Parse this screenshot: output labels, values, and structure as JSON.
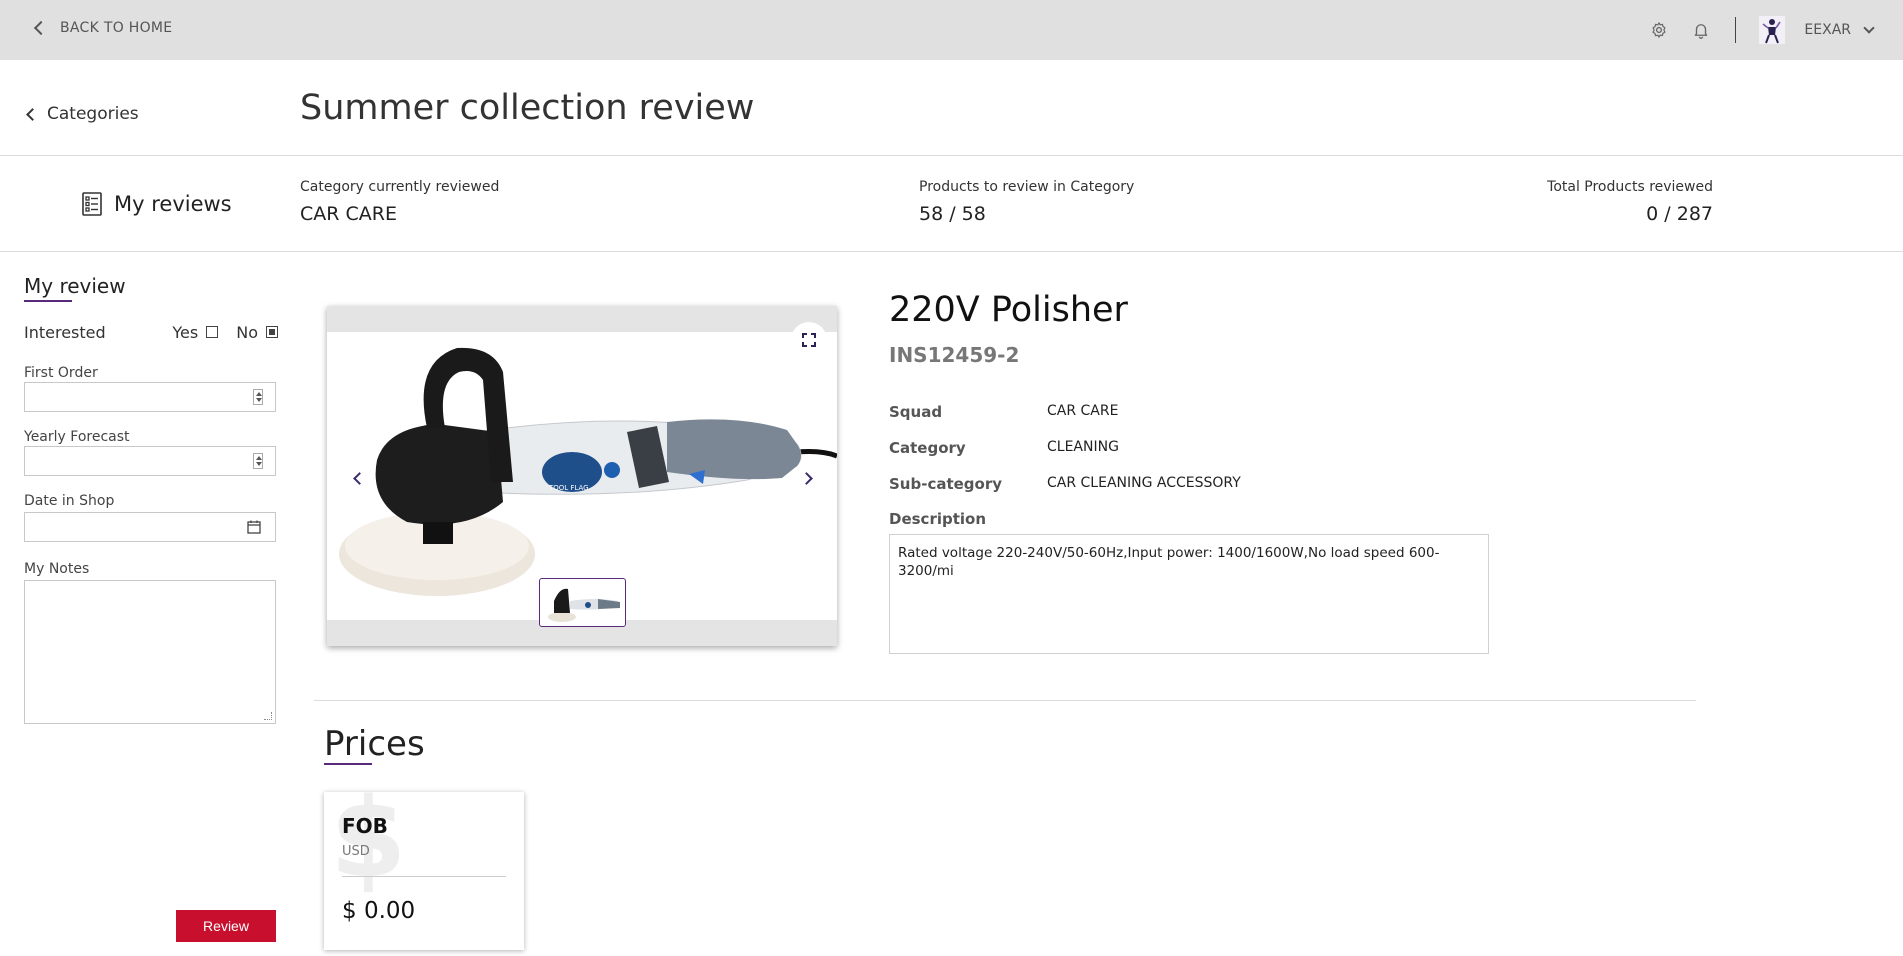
{
  "topbar": {
    "back_label": "BACK TO HOME",
    "user_name": "EEXAR"
  },
  "header": {
    "categories_label": "Categories",
    "title": "Summer collection review"
  },
  "stats": {
    "my_reviews_label": "My reviews",
    "category_caption": "Category currently reviewed",
    "category_value": "CAR CARE",
    "to_review_caption": "Products to review in Category",
    "to_review_value": "58 / 58",
    "total_caption": "Total Products reviewed",
    "total_value": "0 / 287"
  },
  "review_panel": {
    "title": "My review",
    "interested_label": "Interested",
    "yes_label": "Yes",
    "no_label": "No",
    "interested_yes": false,
    "interested_no": true,
    "first_order_label": "First Order",
    "first_order_value": "",
    "yearly_forecast_label": "Yearly Forecast",
    "yearly_forecast_value": "",
    "date_in_shop_label": "Date in Shop",
    "date_in_shop_value": "",
    "notes_label": "My Notes",
    "notes_value": "",
    "review_button": "Review"
  },
  "product": {
    "name": "220V Polisher",
    "code": "INS12459-2",
    "squad_label": "Squad",
    "squad_value": "CAR CARE",
    "category_label": "Category",
    "category_value": "CLEANING",
    "subcategory_label": "Sub-category",
    "subcategory_value": "CAR CLEANING ACCESSORY",
    "description_label": "Description",
    "description_value": "Rated voltage 220-240V/50-60Hz,Input power: 1400/1600W,No load speed 600-3200/mi",
    "image_brand_text": "TOOL FLAG"
  },
  "prices": {
    "title": "Prices",
    "cards": [
      {
        "label": "FOB",
        "currency": "USD",
        "amount": "$ 0.00"
      }
    ]
  },
  "colors": {
    "topbar_bg": "#e0e0e0",
    "accent_purple": "#5a2a7a",
    "review_button_red": "#c8102e"
  }
}
